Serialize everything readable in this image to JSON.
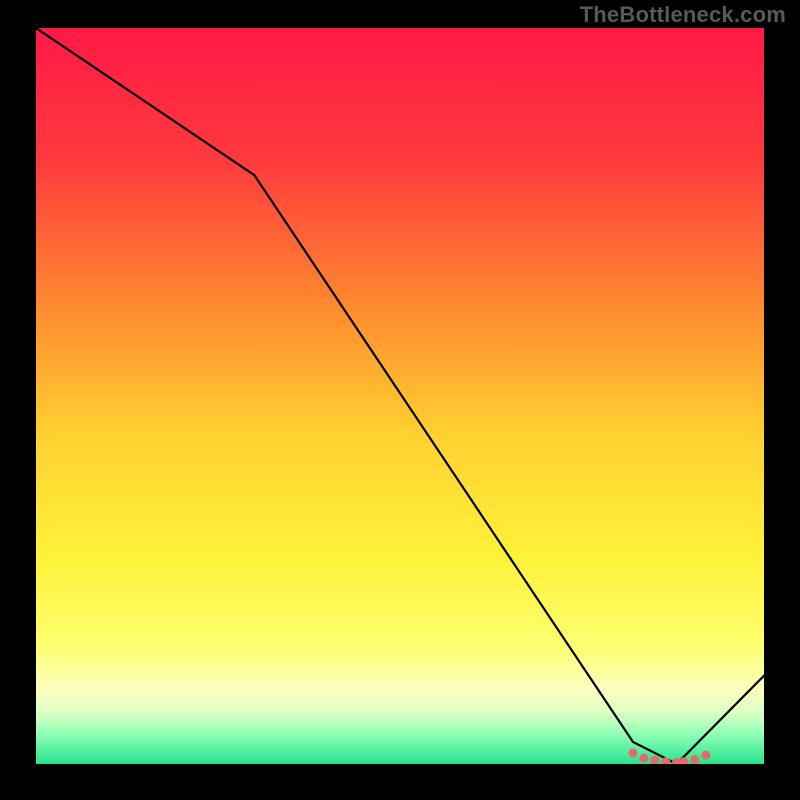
{
  "attribution": "TheBottleneck.com",
  "chart_data": {
    "type": "line",
    "title": "",
    "xlabel": "",
    "ylabel": "",
    "xlim": [
      0,
      100
    ],
    "ylim": [
      0,
      100
    ],
    "x": [
      0,
      30,
      82,
      88,
      100
    ],
    "values": [
      100,
      80,
      3,
      0,
      12
    ],
    "markers": {
      "x": [
        82,
        83.5,
        85,
        86.5,
        88,
        89,
        90.5,
        92
      ],
      "values": [
        1.5,
        0.8,
        0.5,
        0.3,
        0.2,
        0.3,
        0.6,
        1.2
      ]
    },
    "gradient_stops": [
      {
        "offset": 0.0,
        "color": "#ff1946"
      },
      {
        "offset": 0.18,
        "color": "#ff3a3d"
      },
      {
        "offset": 0.38,
        "color": "#ff8a2f"
      },
      {
        "offset": 0.55,
        "color": "#ffd030"
      },
      {
        "offset": 0.72,
        "color": "#fff23a"
      },
      {
        "offset": 0.84,
        "color": "#fdff70"
      },
      {
        "offset": 0.9,
        "color": "#fbffc0"
      },
      {
        "offset": 0.93,
        "color": "#dcffc4"
      },
      {
        "offset": 0.96,
        "color": "#8dffb4"
      },
      {
        "offset": 1.0,
        "color": "#27e28d"
      }
    ],
    "marker_color": "#e86a6a",
    "line_color": "#000000"
  }
}
